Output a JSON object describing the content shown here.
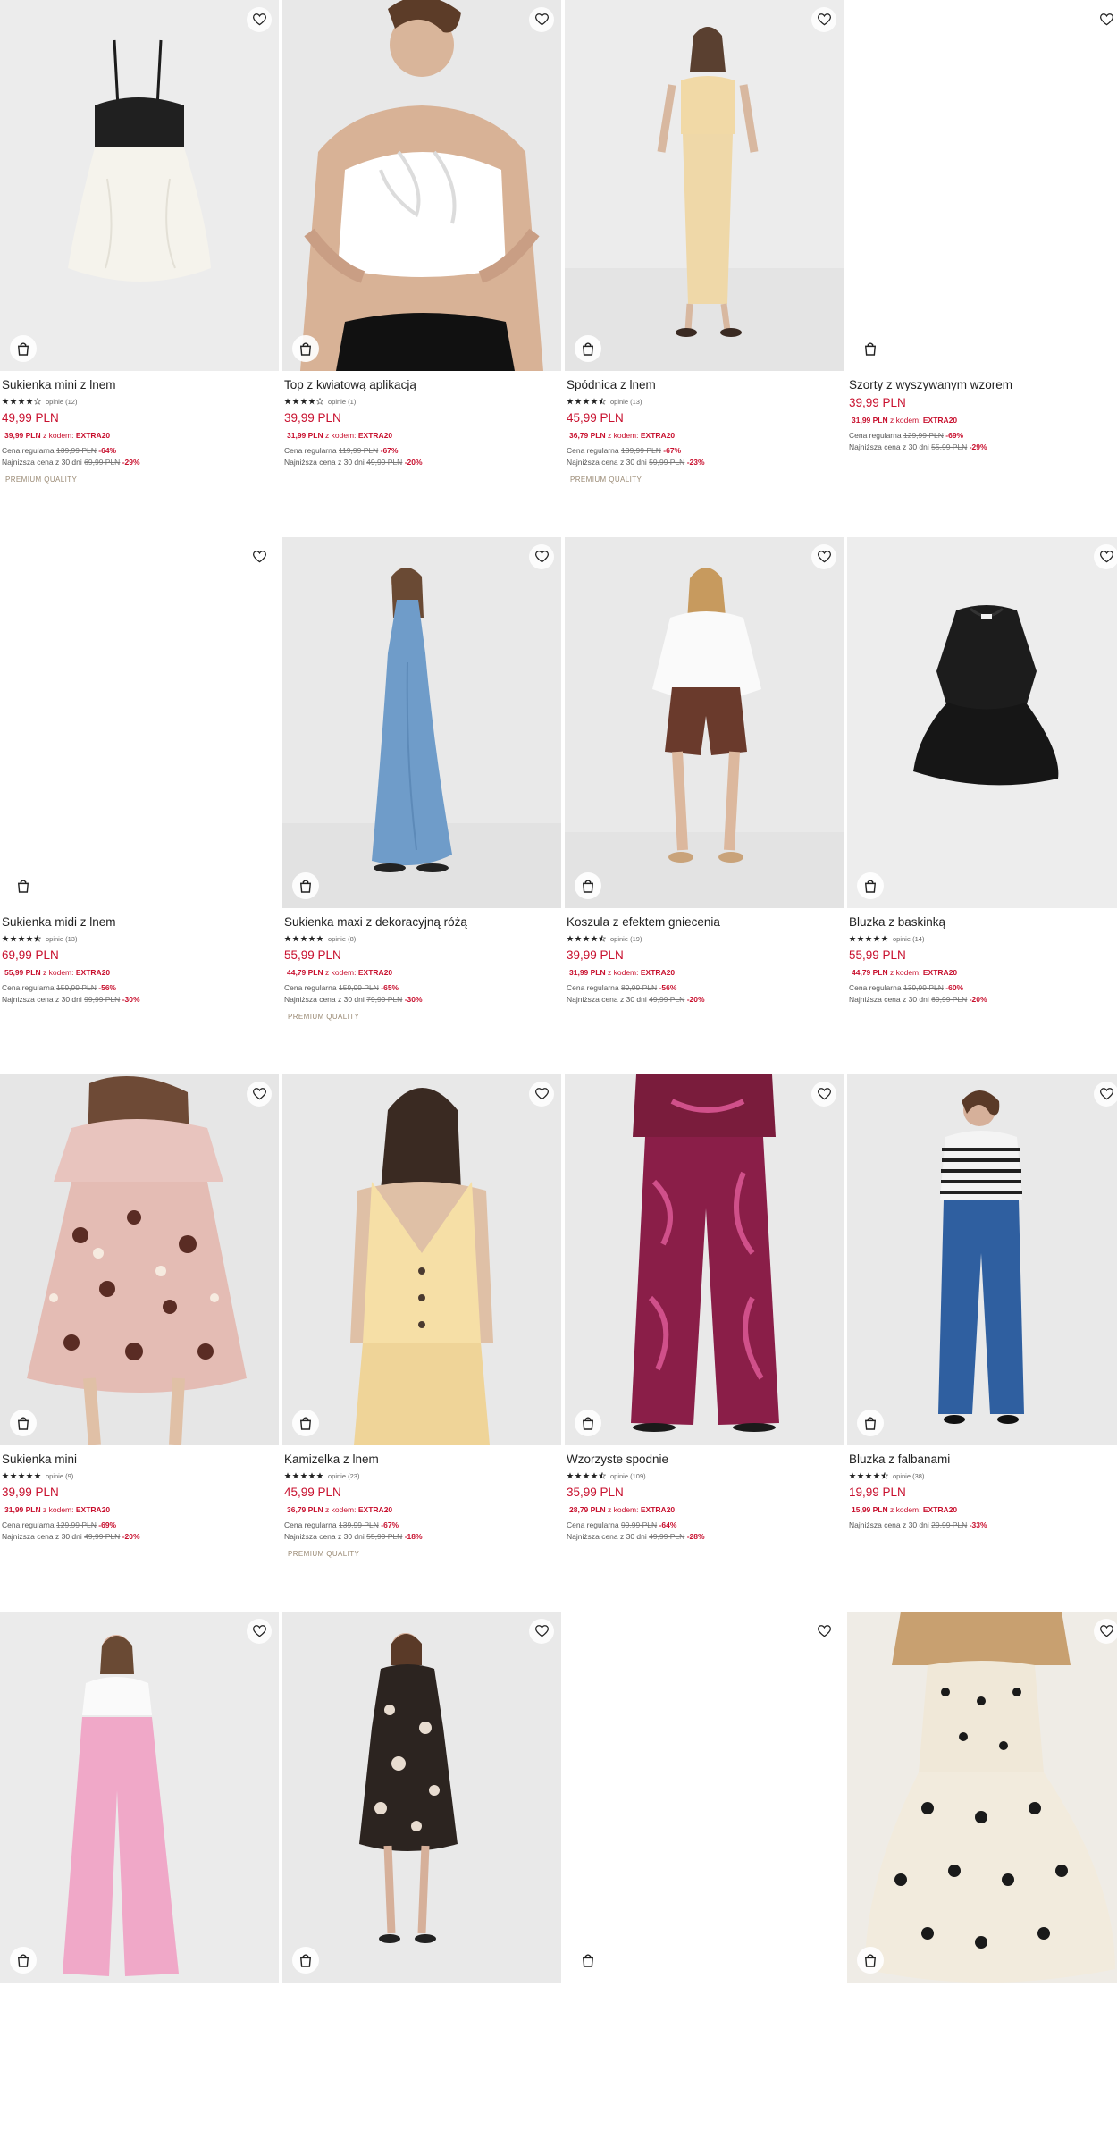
{
  "labels": {
    "reviews_word": "opinie",
    "promo_with_code": "z kodem:",
    "regular_price_label": "Cena regularna",
    "lowest_30_label": "Najniższa cena z 30 dni"
  },
  "products": [
    {
      "name": "Sukienka mini z lnem",
      "rating": 4,
      "reviews": "(12)",
      "price": "49,99 PLN",
      "promo_price": "39,99 PLN",
      "promo_code": "EXTRA20",
      "regular_price": "139,99 PLN",
      "regular_discount": "-64%",
      "lowest_price": "69,99 PLN",
      "lowest_discount": "-29%",
      "badge": "PREMIUM QUALITY",
      "image": "white-dress",
      "background": "#ececec"
    },
    {
      "name": "Top z kwiatową aplikacją",
      "rating": 4,
      "reviews": "(1)",
      "price": "39,99 PLN",
      "promo_price": "31,99 PLN",
      "promo_code": "EXTRA20",
      "regular_price": "119,99 PLN",
      "regular_discount": "-67%",
      "lowest_price": "49,99 PLN",
      "lowest_discount": "-20%",
      "badge": "",
      "image": "flower-top",
      "background": "#e8e8e8"
    },
    {
      "name": "Spódnica z lnem",
      "rating": 4.5,
      "reviews": "(13)",
      "price": "45,99 PLN",
      "promo_price": "36,79 PLN",
      "promo_code": "EXTRA20",
      "regular_price": "139,99 PLN",
      "regular_discount": "-67%",
      "lowest_price": "59,99 PLN",
      "lowest_discount": "-23%",
      "badge": "PREMIUM QUALITY",
      "image": "linen-set",
      "background": "#ececec"
    },
    {
      "name": "Szorty z wyszywanym wzorem",
      "rating": 0,
      "reviews": "",
      "price": "39,99 PLN",
      "promo_price": "31,99 PLN",
      "promo_code": "EXTRA20",
      "regular_price": "129,99 PLN",
      "regular_discount": "-69%",
      "lowest_price": "55,99 PLN",
      "lowest_discount": "-29%",
      "badge": "",
      "image": "blank",
      "background": "#ffffff"
    },
    {
      "name": "Sukienka midi z lnem",
      "rating": 4.5,
      "reviews": "(13)",
      "price": "69,99 PLN",
      "promo_price": "55,99 PLN",
      "promo_code": "EXTRA20",
      "regular_price": "159,99 PLN",
      "regular_discount": "-56%",
      "lowest_price": "99,99 PLN",
      "lowest_discount": "-30%",
      "badge": "",
      "image": "blank",
      "background": "#ffffff"
    },
    {
      "name": "Sukienka maxi z dekoracyjną różą",
      "rating": 5,
      "reviews": "(8)",
      "price": "55,99 PLN",
      "promo_price": "44,79 PLN",
      "promo_code": "EXTRA20",
      "regular_price": "159,99 PLN",
      "regular_discount": "-65%",
      "lowest_price": "79,99 PLN",
      "lowest_discount": "-30%",
      "badge": "PREMIUM QUALITY",
      "image": "blue-maxi",
      "background": "#e9e9e9"
    },
    {
      "name": "Koszula z efektem gniecenia",
      "rating": 4.5,
      "reviews": "(19)",
      "price": "39,99 PLN",
      "promo_price": "31,99 PLN",
      "promo_code": "EXTRA20",
      "regular_price": "89,99 PLN",
      "regular_discount": "-56%",
      "lowest_price": "49,99 PLN",
      "lowest_discount": "-20%",
      "badge": "",
      "image": "shirt-shorts",
      "background": "#e9e9e9"
    },
    {
      "name": "Bluzka z baskinką",
      "rating": 5,
      "reviews": "(14)",
      "price": "55,99 PLN",
      "promo_price": "44,79 PLN",
      "promo_code": "EXTRA20",
      "regular_price": "139,99 PLN",
      "regular_discount": "-60%",
      "lowest_price": "69,99 PLN",
      "lowest_discount": "-20%",
      "badge": "",
      "image": "peplum-top",
      "background": "#ededed"
    },
    {
      "name": "Sukienka mini",
      "rating": 5,
      "reviews": "(9)",
      "price": "39,99 PLN",
      "promo_price": "31,99 PLN",
      "promo_code": "EXTRA20",
      "regular_price": "129,99 PLN",
      "regular_discount": "-69%",
      "lowest_price": "49,99 PLN",
      "lowest_discount": "-20%",
      "badge": "",
      "image": "floral-mini",
      "background": "#e6e6e6"
    },
    {
      "name": "Kamizelka z lnem",
      "rating": 5,
      "reviews": "(23)",
      "price": "45,99 PLN",
      "promo_price": "36,79 PLN",
      "promo_code": "EXTRA20",
      "regular_price": "139,99 PLN",
      "regular_discount": "-67%",
      "lowest_price": "55,99 PLN",
      "lowest_discount": "-18%",
      "badge": "PREMIUM QUALITY",
      "image": "vest",
      "background": "#e8e8e8"
    },
    {
      "name": "Wzorzyste spodnie",
      "rating": 4.5,
      "reviews": "(109)",
      "price": "35,99 PLN",
      "promo_price": "28,79 PLN",
      "promo_code": "EXTRA20",
      "regular_price": "99,99 PLN",
      "regular_discount": "-64%",
      "lowest_price": "49,99 PLN",
      "lowest_discount": "-28%",
      "badge": "",
      "image": "patterned-pants",
      "background": "#e9e9e9"
    },
    {
      "name": "Bluzka z falbanami",
      "rating": 4.5,
      "reviews": "(38)",
      "price": "19,99 PLN",
      "promo_price": "15,99 PLN",
      "promo_code": "EXTRA20",
      "regular_price": "",
      "regular_discount": "",
      "lowest_price": "29,99 PLN",
      "lowest_discount": "-33%",
      "badge": "",
      "image": "striped-top",
      "background": "#e9e9e9"
    },
    {
      "name": "",
      "rating": 0,
      "reviews": "",
      "price": "",
      "promo_price": "",
      "promo_code": "",
      "regular_price": "",
      "regular_discount": "",
      "lowest_price": "",
      "lowest_discount": "",
      "badge": "",
      "image": "pink-pants",
      "background": "#ebebeb"
    },
    {
      "name": "",
      "rating": 0,
      "reviews": "",
      "price": "",
      "promo_price": "",
      "promo_code": "",
      "regular_price": "",
      "regular_discount": "",
      "lowest_price": "",
      "lowest_discount": "",
      "badge": "",
      "image": "printed-dress",
      "background": "#e9e9e9"
    },
    {
      "name": "",
      "rating": 0,
      "reviews": "",
      "price": "",
      "promo_price": "",
      "promo_code": "",
      "regular_price": "",
      "regular_discount": "",
      "lowest_price": "",
      "lowest_discount": "",
      "badge": "",
      "image": "blank",
      "background": "#ffffff"
    },
    {
      "name": "",
      "rating": 0,
      "reviews": "",
      "price": "",
      "promo_price": "",
      "promo_code": "",
      "regular_price": "",
      "regular_discount": "",
      "lowest_price": "",
      "lowest_discount": "",
      "badge": "",
      "image": "polka-dress",
      "background": "#efece6"
    }
  ],
  "icons": {
    "favorite": "heart-outline-icon",
    "cart": "shopping-bag-icon",
    "rating": "star-icon"
  },
  "colors": {
    "price": "#c8102e",
    "text": "#222222",
    "muted": "#555555",
    "badge": "#9a8a74"
  }
}
